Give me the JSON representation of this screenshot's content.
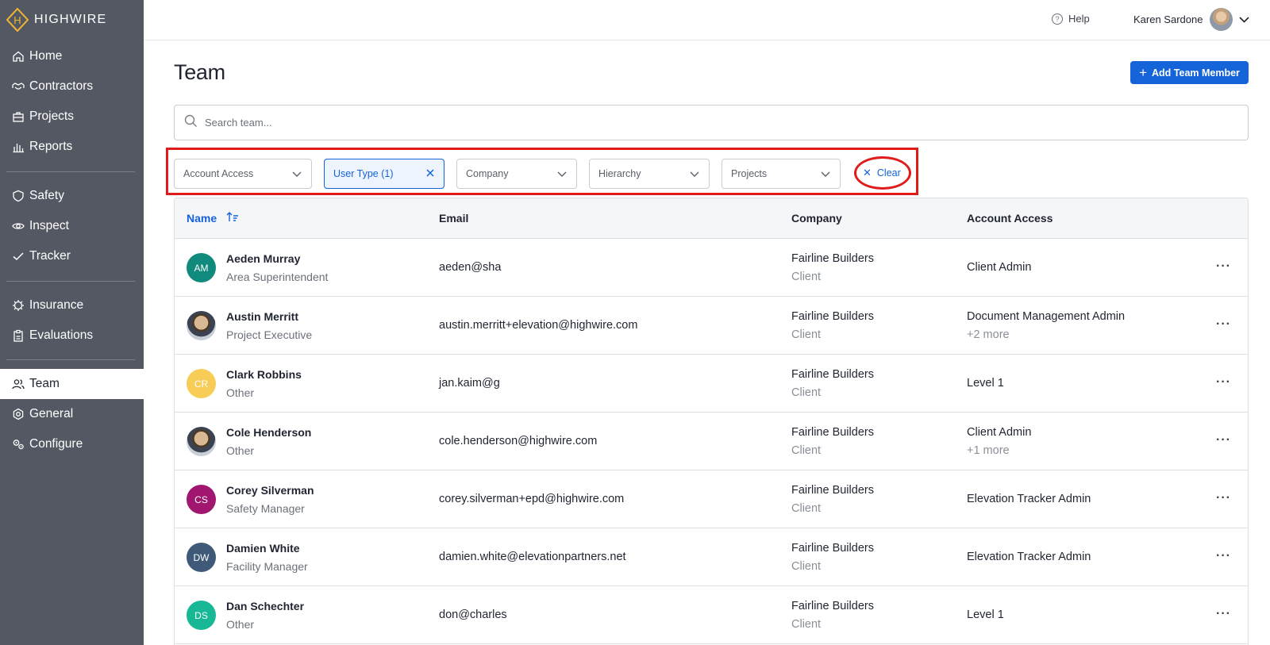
{
  "brand": {
    "name": "HIGHWIRE",
    "logo_letter": "H"
  },
  "sidebar": {
    "items": [
      {
        "label": "Home",
        "icon": "home-icon"
      },
      {
        "label": "Contractors",
        "icon": "handshake-icon"
      },
      {
        "label": "Projects",
        "icon": "briefcase-icon"
      },
      {
        "label": "Reports",
        "icon": "bar-chart-icon"
      },
      {
        "label": "Safety",
        "icon": "shield-icon"
      },
      {
        "label": "Inspect",
        "icon": "eye-icon"
      },
      {
        "label": "Tracker",
        "icon": "check-icon"
      },
      {
        "label": "Insurance",
        "icon": "umbrella-icon"
      },
      {
        "label": "Evaluations",
        "icon": "clipboard-icon"
      },
      {
        "label": "Team",
        "icon": "users-icon",
        "active": true
      },
      {
        "label": "General",
        "icon": "gear-icon"
      },
      {
        "label": "Configure",
        "icon": "gears-icon"
      }
    ]
  },
  "topbar": {
    "help": "Help",
    "user_name": "Karen Sardone"
  },
  "main": {
    "title": "Team",
    "add_button": "Add Team Member",
    "search_placeholder": "Search team...",
    "filters": [
      "Account Access",
      "User Type (1)",
      "Company",
      "Hierarchy",
      "Projects"
    ],
    "clear": "Clear"
  },
  "table": {
    "columns": [
      "Name",
      "Email",
      "Company",
      "Account Access"
    ],
    "rows": [
      {
        "initials": "AM",
        "name": "Aeden Murray",
        "role": "Area Superintendent",
        "email": "aeden@sha",
        "company": "Fairline Builders",
        "company_type": "Client",
        "access": "Client Admin",
        "access_more": ""
      },
      {
        "initials": "",
        "name": "Austin Merritt",
        "role": "Project Executive",
        "email": "austin.merritt+elevation@highwire.com",
        "company": "Fairline Builders",
        "company_type": "Client",
        "access": "Document Management Admin",
        "access_more": "+2 more"
      },
      {
        "initials": "CR",
        "name": "Clark Robbins",
        "role": "Other",
        "email": "jan.kaim@g",
        "company": "Fairline Builders",
        "company_type": "Client",
        "access": "Level 1",
        "access_more": ""
      },
      {
        "initials": "",
        "name": "Cole Henderson",
        "role": "Other",
        "email": "cole.henderson@highwire.com",
        "company": "Fairline Builders",
        "company_type": "Client",
        "access": "Client Admin",
        "access_more": "+1 more"
      },
      {
        "initials": "CS",
        "name": "Corey Silverman",
        "role": "Safety Manager",
        "email": "corey.silverman+epd@highwire.com",
        "company": "Fairline Builders",
        "company_type": "Client",
        "access": "Elevation Tracker Admin",
        "access_more": ""
      },
      {
        "initials": "DW",
        "name": "Damien White",
        "role": "Facility Manager",
        "email": "damien.white@elevationpartners.net",
        "company": "Fairline Builders",
        "company_type": "Client",
        "access": "Elevation Tracker Admin",
        "access_more": ""
      },
      {
        "initials": "DS",
        "name": "Dan Schechter",
        "role": "Other",
        "email": "don@charles",
        "company": "Fairline Builders",
        "company_type": "Client",
        "access": "Level 1",
        "access_more": ""
      }
    ]
  },
  "colors": {
    "sidebar_bg": "#535862",
    "accent": "#1463d9",
    "highlight": "#e11b1b",
    "avatar_colors": [
      "#0f8a7c",
      "",
      "#f7cd57",
      "",
      "#a1166f",
      "#3e5a78",
      "#18b896"
    ]
  }
}
